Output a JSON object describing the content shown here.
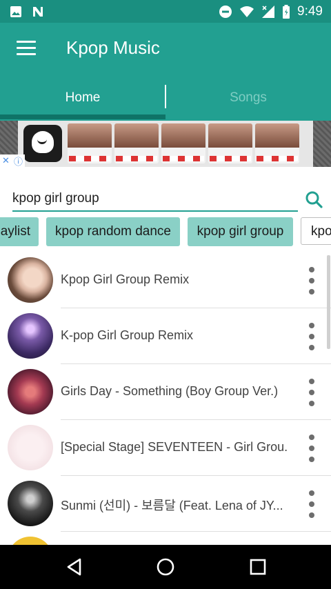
{
  "status_bar": {
    "time": "9:49",
    "left_icons": [
      "image-icon",
      "n-icon"
    ],
    "right_icons": [
      "do-not-disturb-icon",
      "wifi-icon",
      "signal-icon",
      "battery-icon"
    ]
  },
  "app_bar": {
    "title": "Kpop Music",
    "menu_icon": "hamburger-menu-icon"
  },
  "tabs": [
    {
      "label": "Home",
      "selected": true
    },
    {
      "label": "Songs",
      "selected": false
    }
  ],
  "search": {
    "value": "kpop girl group",
    "icon": "search-icon"
  },
  "chips": [
    {
      "label": "Playlist",
      "style": "filled"
    },
    {
      "label": "kpop random dance",
      "style": "filled"
    },
    {
      "label": "kpop girl group",
      "style": "filled"
    },
    {
      "label": "kpop",
      "style": "outlined"
    }
  ],
  "songs": [
    {
      "title": "Kpop Girl  Group Remix"
    },
    {
      "title": "K-pop Girl Group Remix"
    },
    {
      "title": "Girls Day - Something (Boy Group Ver.)"
    },
    {
      "title": "[Special Stage] SEVENTEEN - Girl Grou..."
    },
    {
      "title": "Sunmi (선미) - 보름달 (Feat. Lena of JY..."
    }
  ],
  "colors": {
    "status_bar": "#1a8f80",
    "app_bar": "#22a091",
    "chip_fill": "#8ad0c6",
    "tab_indicator": "#0f7367"
  },
  "nav_bar": {
    "icons": [
      "back-icon",
      "home-icon",
      "recents-icon"
    ]
  }
}
